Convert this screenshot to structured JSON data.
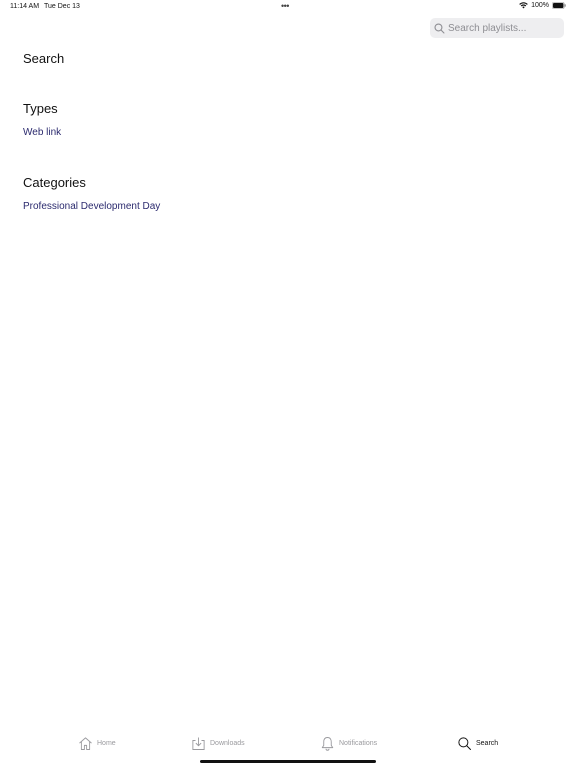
{
  "status_bar": {
    "time": "11:14 AM",
    "date": "Tue Dec 13",
    "dots": "•••",
    "battery": "100%"
  },
  "search": {
    "placeholder": "Search playlists...",
    "value": ""
  },
  "page": {
    "title": "Search"
  },
  "types": {
    "heading": "Types",
    "items": [
      "Web link"
    ]
  },
  "categories": {
    "heading": "Categories",
    "items": [
      "Professional Development Day"
    ]
  },
  "tab_bar": {
    "tabs": [
      {
        "label": "Home",
        "icon": "home-icon"
      },
      {
        "label": "Downloads",
        "icon": "download-icon"
      },
      {
        "label": "Notifications",
        "icon": "bell-icon"
      },
      {
        "label": "Search",
        "icon": "search-icon",
        "active": true
      }
    ]
  },
  "colors": {
    "link": "#2b2a6e",
    "inactive_tab": "#9a9a9e",
    "search_bg": "#eeeef0"
  }
}
